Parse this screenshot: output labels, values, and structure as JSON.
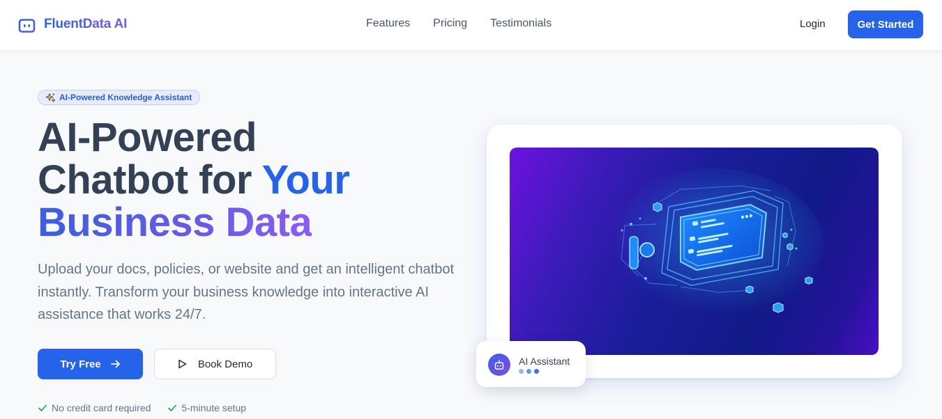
{
  "header": {
    "brand": "FluentData AI",
    "nav": [
      "Features",
      "Pricing",
      "Testimonials"
    ],
    "login_label": "Login",
    "cta_label": "Get Started"
  },
  "hero": {
    "badge_label": "AI-Powered Knowledge Assistant",
    "title_line1": "AI-Powered",
    "title_line2_plain": "Chatbot for ",
    "title_line2_accent": "Your",
    "title_line3": "Business Data",
    "subtitle": "Upload your docs, policies, or website and get an intelligent chatbot instantly. Transform your business knowledge into interactive AI assistance that works 24/7.",
    "primary_button": "Try Free",
    "secondary_button": "Book Demo",
    "checks": [
      "No credit card required",
      "5-minute setup"
    ]
  },
  "assistant_card": {
    "label": "AI Assistant"
  },
  "colors": {
    "primary": "#2563eb",
    "accent_purple": "#8b5cf6",
    "heading": "#334155",
    "body_text": "#64748b",
    "success": "#16a34a",
    "typing_dots": [
      "#93b4f5",
      "#6b93ee",
      "#3f6fe3"
    ]
  },
  "icons": {
    "logo": "robot-icon",
    "badge": "sparkle-icon",
    "try_free": "arrow-right-icon",
    "book_demo": "play-icon",
    "checks": "checkmark-icon",
    "assistant": "robot-icon"
  }
}
